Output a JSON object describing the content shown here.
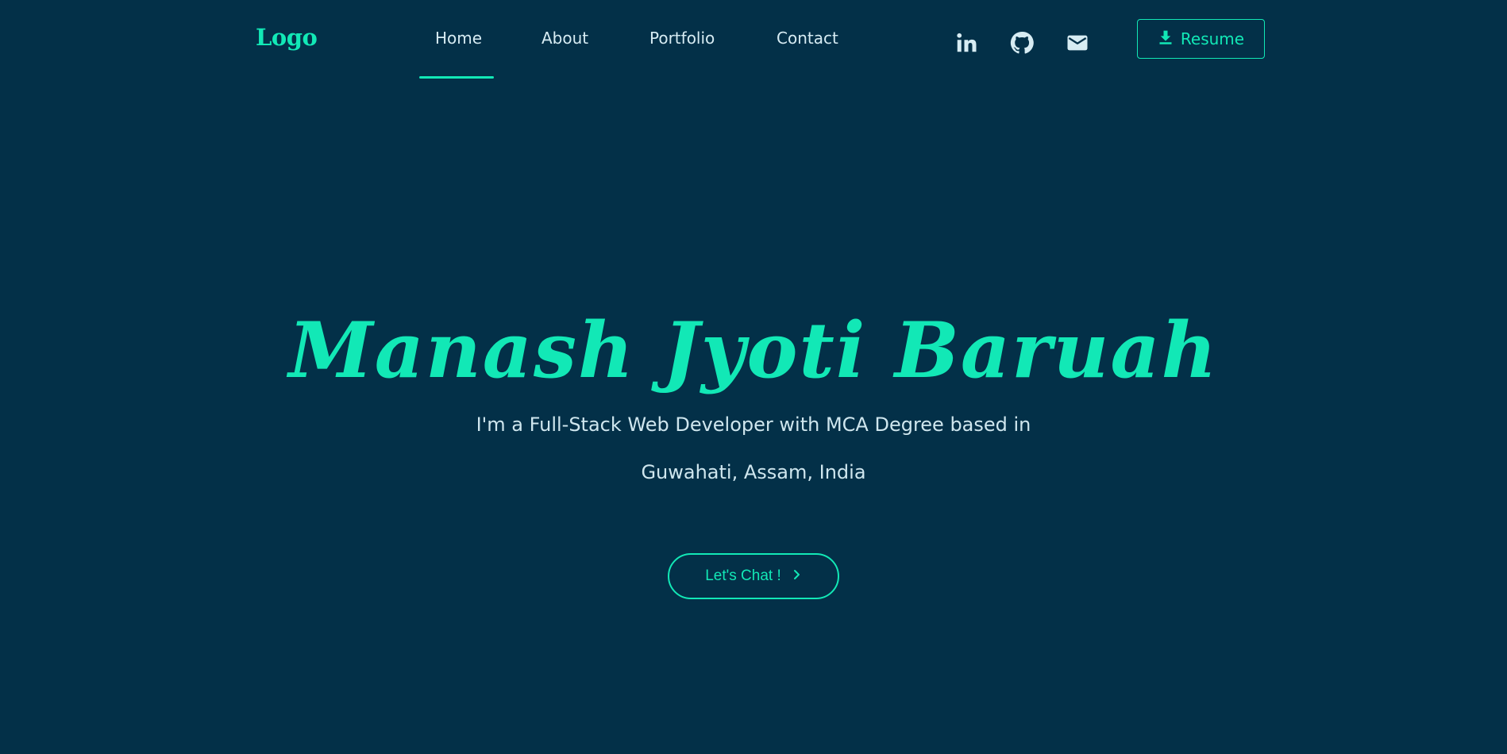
{
  "header": {
    "logo": "Logo",
    "nav": [
      {
        "label": "Home",
        "active": true
      },
      {
        "label": "About",
        "active": false
      },
      {
        "label": "Portfolio",
        "active": false
      },
      {
        "label": "Contact",
        "active": false
      }
    ],
    "social_icons": [
      "linkedin-icon",
      "github-icon",
      "mail-icon"
    ],
    "resume_label": "Resume",
    "resume_icon": "download-icon"
  },
  "hero": {
    "name": "Manash Jyoti Baruah",
    "tagline_line1": "I'm a Full-Stack Web Developer with MCA Degree based in",
    "tagline_line2": "Guwahati, Assam, India",
    "cta_label": "Let's Chat !",
    "cta_icon": "chevron-right-icon"
  },
  "colors": {
    "background": "#033048",
    "accent": "#12e8b6",
    "text": "#d7ecf3"
  }
}
